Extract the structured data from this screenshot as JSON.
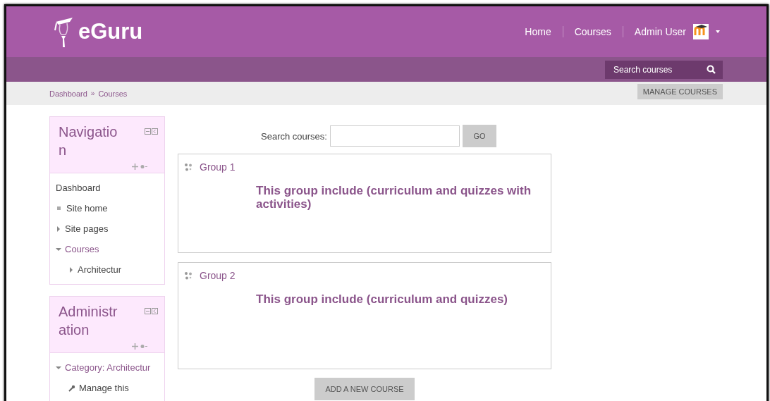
{
  "header": {
    "logo_text": "eGuru",
    "nav_links": [
      {
        "label": "Home"
      },
      {
        "label": "Courses"
      }
    ],
    "user_menu": {
      "name": "Admin User"
    }
  },
  "search_bar": {
    "placeholder": "Search courses"
  },
  "breadcrumb": {
    "items": [
      "Dashboard",
      "Courses"
    ],
    "separator": "»"
  },
  "manage_button": "MANAGE COURSES",
  "blocks": [
    {
      "title": "Navigation",
      "items": [
        {
          "label": "Dashboard",
          "kind": "plain",
          "expanded": false
        },
        {
          "label": "Site home",
          "kind": "leaf",
          "expanded": false
        },
        {
          "label": "Site pages",
          "kind": "branch",
          "expanded": false
        },
        {
          "label": "Courses",
          "kind": "branch",
          "expanded": true,
          "children": [
            {
              "label": "Architectur",
              "kind": "branch",
              "expanded": false
            }
          ]
        }
      ]
    },
    {
      "title": "Administration",
      "items": [
        {
          "label": "Category: Architectur",
          "kind": "branch",
          "expanded": true,
          "children": [
            {
              "label": "Manage this",
              "kind": "tool",
              "expanded": false
            }
          ]
        }
      ]
    }
  ],
  "course_search": {
    "label": "Search courses:",
    "button": "GO"
  },
  "groups": [
    {
      "name": "Group 1",
      "description": "This group include (curriculum and quizzes with activities)"
    },
    {
      "name": "Group 2",
      "description": "This group include (curriculum and quizzes)"
    }
  ],
  "add_button": "ADD A NEW COURSE"
}
